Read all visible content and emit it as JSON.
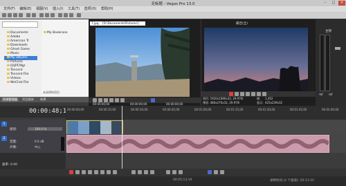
{
  "window": {
    "title": "无标题 - Vegas Pro 13.0"
  },
  "menu": {
    "items": [
      "文件(F)",
      "编辑(E)",
      "视图(V)",
      "插入(I)",
      "工具(T)",
      "选项(O)",
      "帮助(H)"
    ]
  },
  "explorer": {
    "tree": [
      "Documents",
      "Adobe",
      "American Tr",
      "Downloads",
      "Ghost Game",
      "Music",
      "My albums",
      "Pictures",
      "QQPCMgr",
      "Tencent",
      "Tencent File",
      "Videos",
      "WeChat File"
    ],
    "selected_index": 6,
    "file_list": [
      "My Bookcase"
    ],
    "status": "未选择的项目"
  },
  "tabs": [
    "资源管理器",
    "项目媒体",
    "效果"
  ],
  "trimmer": {
    "path": "7.jpg",
    "folder": "[D:\\Documents\\Pictures\\]",
    "time_in": "00:00:00;00",
    "time_out": "00:00:00;00",
    "duration": "00:00:00;00"
  },
  "preview": {
    "mode": "最佳(全)",
    "project_info": "项目: 1920x1080x32, 29.970i",
    "preview_info": "预览: 480x270x32, 29.970i",
    "frame_label": "帧:",
    "frame_value": "1,452",
    "display_label": "显示:",
    "display_value": "425x239x32"
  },
  "mixer": {
    "label": "主频",
    "db_values": [
      "-Inf",
      "-Inf"
    ]
  },
  "timeline": {
    "timecode": "00:00:48;12",
    "ruler_labels": [
      "00:00:00;00",
      "00:00:15;00",
      "00:00:30;00",
      "00:00:45;00",
      "00:01:00;00",
      "00:01:15;00",
      "00:01:30;00",
      "00:01:45;00",
      "00:02:00;00"
    ],
    "video_track": {
      "label": "级别:",
      "level": "100.0 %"
    },
    "audio_track": {
      "vol_label": "音量:",
      "vol": "0.0 dB",
      "pan_label": "声像:",
      "pan": "中心"
    },
    "rate": "速率: 0.00"
  },
  "status": {
    "time": "00:05:13;19",
    "record": "录制时间 (2 个通道): 50:11:55"
  }
}
